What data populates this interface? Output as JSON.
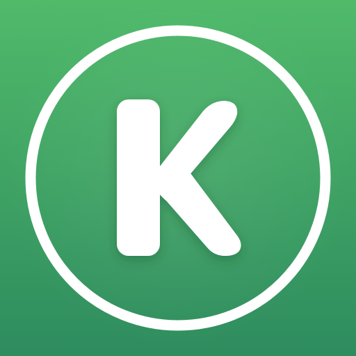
{
  "icon": {
    "letter": "K",
    "colors": {
      "gradient_top": "#50ba6a",
      "gradient_bottom": "#2e8c5e",
      "foreground": "#ffffff"
    }
  }
}
